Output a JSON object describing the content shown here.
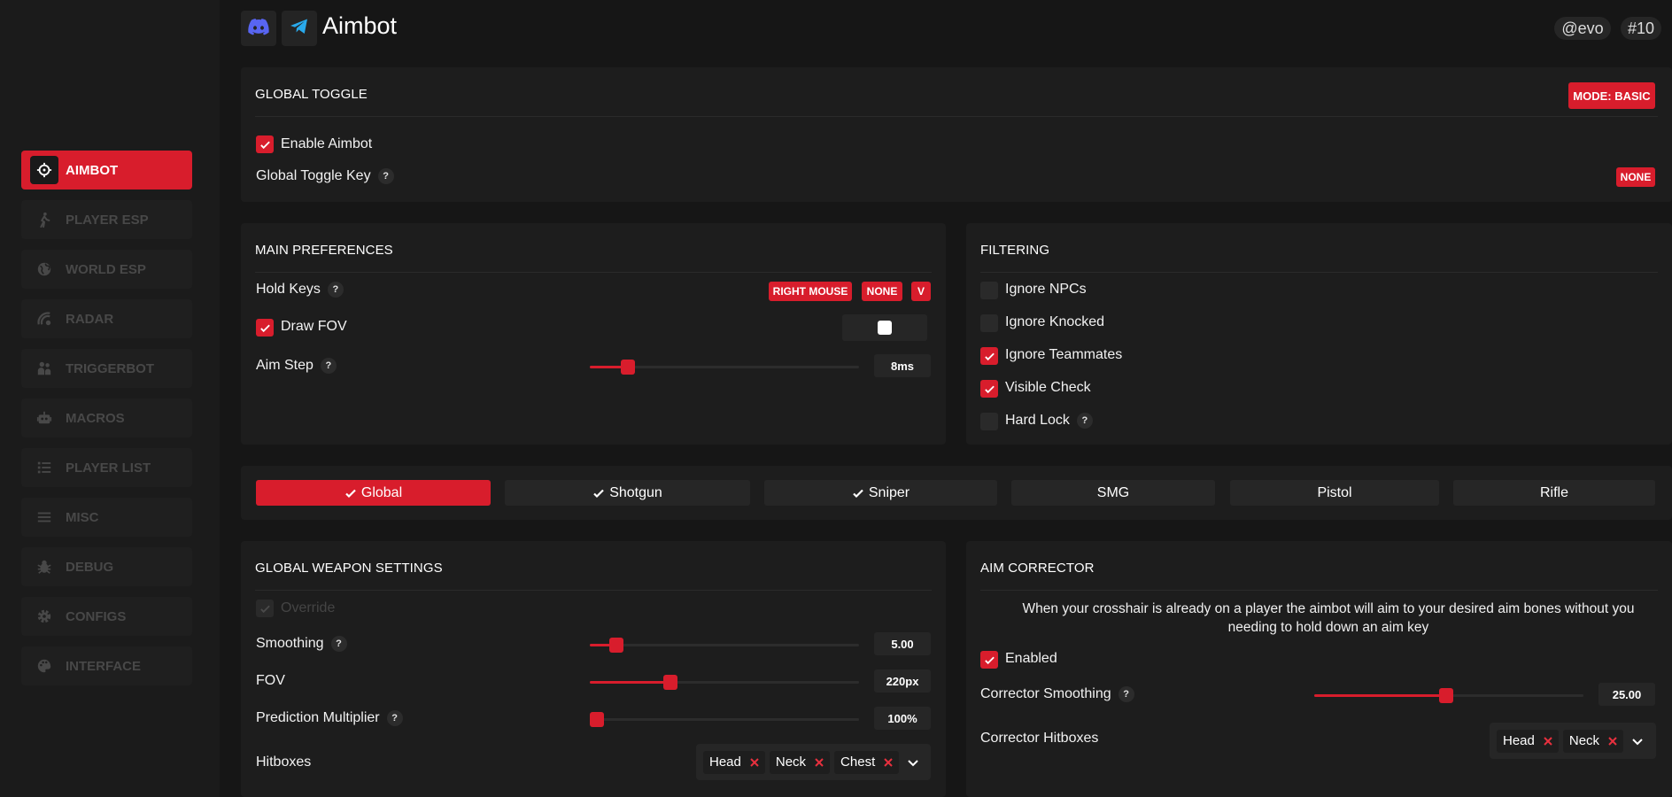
{
  "sidebar": {
    "items": [
      {
        "label": "AIMBOT",
        "icon": "crosshair-icon",
        "active": true
      },
      {
        "label": "PLAYER ESP",
        "icon": "walking-person-icon"
      },
      {
        "label": "WORLD ESP",
        "icon": "globe-icon"
      },
      {
        "label": "RADAR",
        "icon": "radar-icon"
      },
      {
        "label": "TRIGGERBOT",
        "icon": "people-icon"
      },
      {
        "label": "MACROS",
        "icon": "robot-icon"
      },
      {
        "label": "PLAYER LIST",
        "icon": "list-icon"
      },
      {
        "label": "MISC",
        "icon": "menu-icon"
      },
      {
        "label": "DEBUG",
        "icon": "bug-icon"
      },
      {
        "label": "CONFIGS",
        "icon": "gear-icon"
      },
      {
        "label": "INTERFACE",
        "icon": "palette-icon"
      }
    ]
  },
  "header": {
    "title": "Aimbot",
    "user": "@evo",
    "id": "#10"
  },
  "global_toggle": {
    "title": "GLOBAL TOGGLE",
    "mode_label": "MODE: BASIC",
    "enable_label": "Enable Aimbot",
    "enable_checked": true,
    "key_label": "Global Toggle Key",
    "key_value": "NONE"
  },
  "main_prefs": {
    "title": "MAIN PREFERENCES",
    "hold_keys_label": "Hold Keys",
    "hold_keys": [
      "RIGHT MOUSE",
      "NONE",
      "V"
    ],
    "draw_fov_label": "Draw FOV",
    "draw_fov_checked": true,
    "fov_color": "#ffffff",
    "aim_step_label": "Aim Step",
    "aim_step_value": "8ms",
    "aim_step_fraction": 0.14
  },
  "filtering": {
    "title": "FILTERING",
    "items": [
      {
        "label": "Ignore NPCs",
        "checked": false
      },
      {
        "label": "Ignore Knocked",
        "checked": false
      },
      {
        "label": "Ignore Teammates",
        "checked": true
      },
      {
        "label": "Visible Check",
        "checked": true
      },
      {
        "label": "Hard Lock",
        "checked": false,
        "help": true
      }
    ]
  },
  "weapon_tabs": [
    {
      "label": "Global",
      "checked": true,
      "active": true
    },
    {
      "label": "Shotgun",
      "checked": true
    },
    {
      "label": "Sniper",
      "checked": true
    },
    {
      "label": "SMG",
      "checked": false
    },
    {
      "label": "Pistol",
      "checked": false
    },
    {
      "label": "Rifle",
      "checked": false
    }
  ],
  "weapon_settings": {
    "title": "GLOBAL WEAPON SETTINGS",
    "override_label": "Override",
    "smoothing_label": "Smoothing",
    "smoothing_value": "5.00",
    "smoothing_fraction": 0.1,
    "fov_label": "FOV",
    "fov_value": "220px",
    "fov_fraction": 0.3,
    "prediction_label": "Prediction Multiplier",
    "prediction_value": "100%",
    "prediction_fraction": 0.0,
    "hitboxes_label": "Hitboxes",
    "hitboxes": [
      "Head",
      "Neck",
      "Chest"
    ]
  },
  "aim_corrector": {
    "title": "AIM CORRECTOR",
    "description_line1": "When your crosshair is already on a player the aimbot will aim to your desired aim bones without you",
    "description_line2": "needing to hold down an aim key",
    "enabled_label": "Enabled",
    "enabled_checked": true,
    "smoothing_label": "Corrector Smoothing",
    "smoothing_value": "25.00",
    "smoothing_fraction": 0.49,
    "hitboxes_label": "Corrector Hitboxes",
    "hitboxes": [
      "Head",
      "Neck"
    ]
  },
  "colors": {
    "accent": "#d81d2c",
    "background": "#161616",
    "panel": "#1d1d1d"
  }
}
